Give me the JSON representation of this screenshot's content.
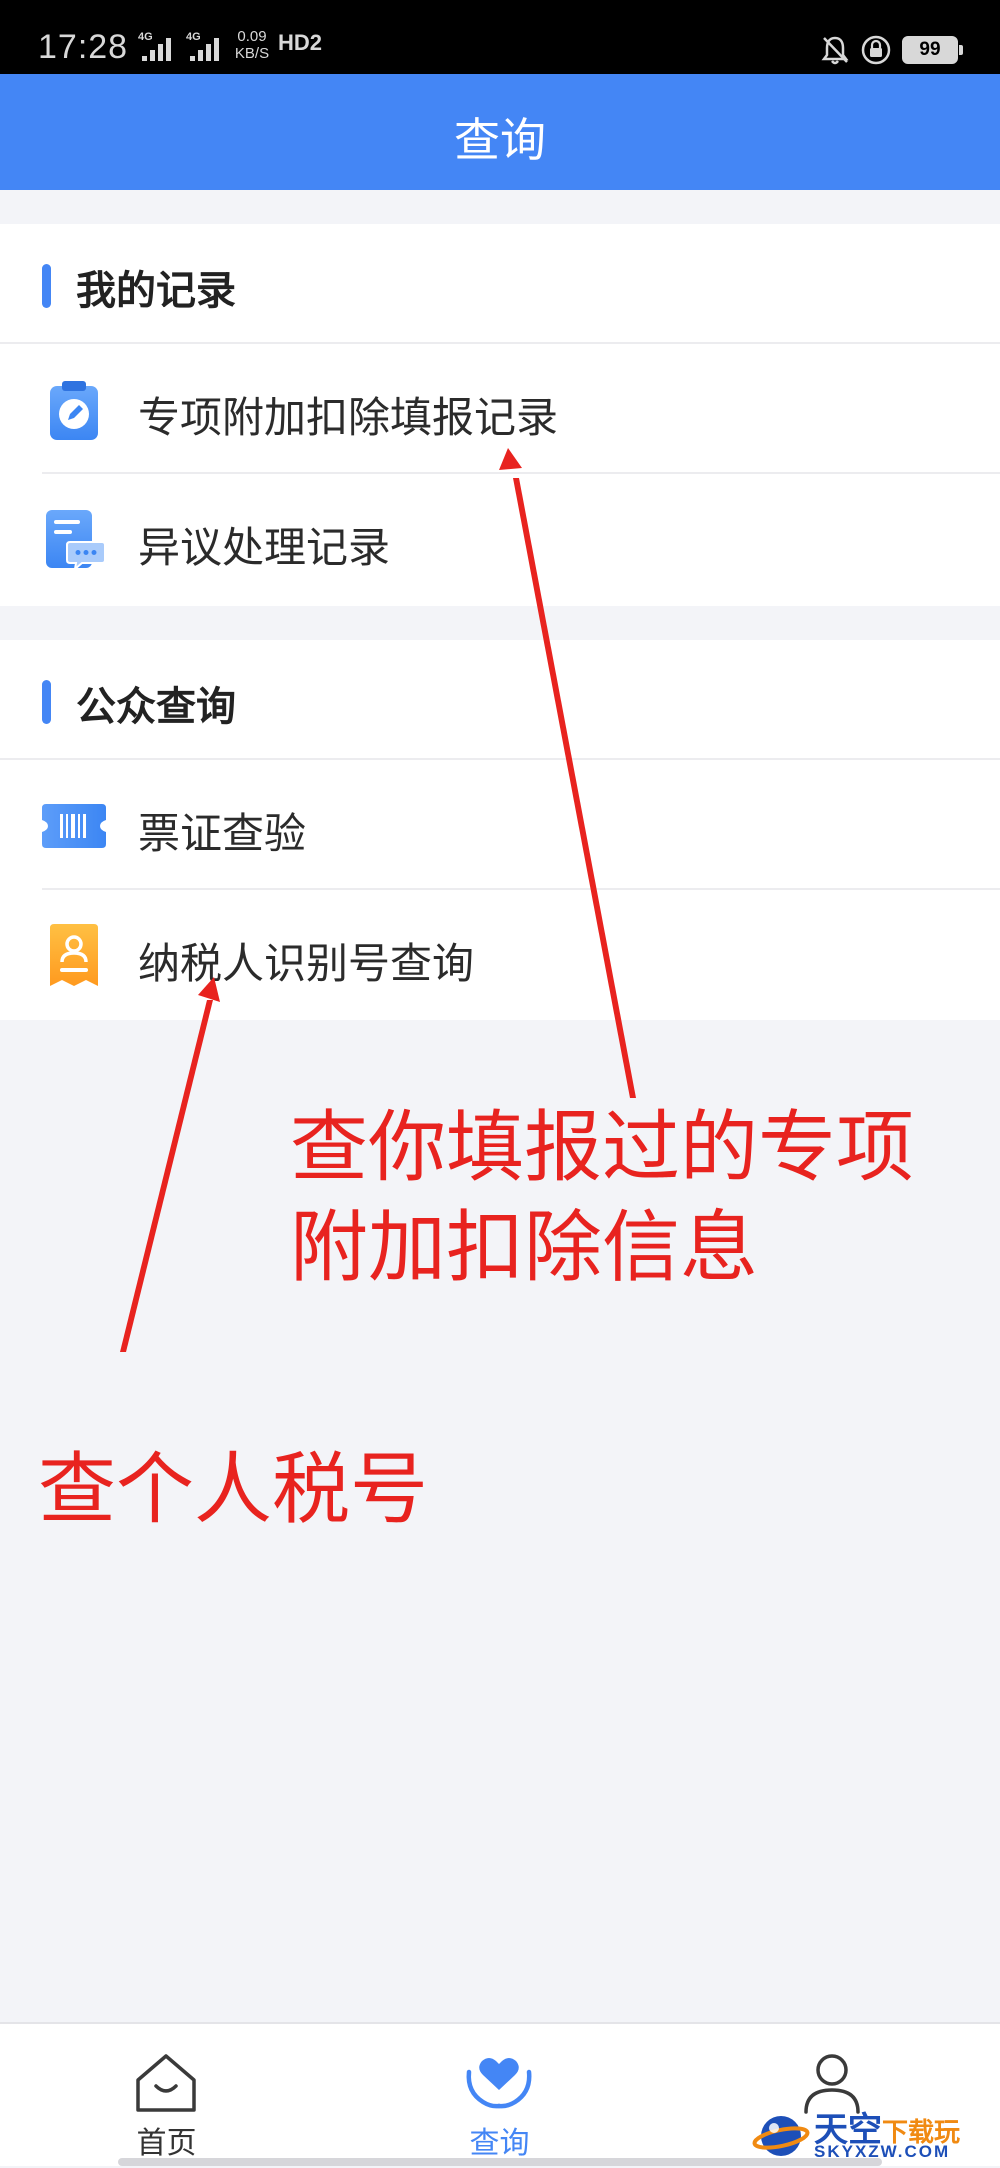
{
  "status_bar": {
    "time": "17:28",
    "network_1": "4G",
    "network_2": "4G",
    "net_speed": "0.09",
    "net_speed_unit": "KB/S",
    "hd": "HD2",
    "battery": "99"
  },
  "header": {
    "title": "查询"
  },
  "sections": [
    {
      "title": "我的记录",
      "items": [
        {
          "label": "专项附加扣除填报记录",
          "icon": "clipboard-pen-icon"
        },
        {
          "label": "异议处理记录",
          "icon": "document-chat-icon"
        }
      ]
    },
    {
      "title": "公众查询",
      "items": [
        {
          "label": "票证查验",
          "icon": "barcode-ticket-icon"
        },
        {
          "label": "纳税人识别号查询",
          "icon": "person-badge-icon"
        }
      ]
    }
  ],
  "annotations": {
    "deduction_note_line1": "查你填报过的专项",
    "deduction_note_line2": "附加扣除信息",
    "taxid_note": "查个人税号",
    "color": "#e8231f"
  },
  "bottom_nav": {
    "tabs": [
      {
        "label": "首页",
        "icon": "home-icon",
        "active": false
      },
      {
        "label": "查询",
        "icon": "heart-hands-icon",
        "active": true
      },
      {
        "label": "",
        "icon": "person-icon",
        "active": false
      }
    ]
  },
  "watermark": {
    "title": "天空",
    "accent": "下载玩",
    "subtitle": "SKYXZW.COM"
  },
  "colors": {
    "brand_blue": "#4486f5",
    "background": "#f3f4f8",
    "annotation_red": "#e8231f"
  }
}
